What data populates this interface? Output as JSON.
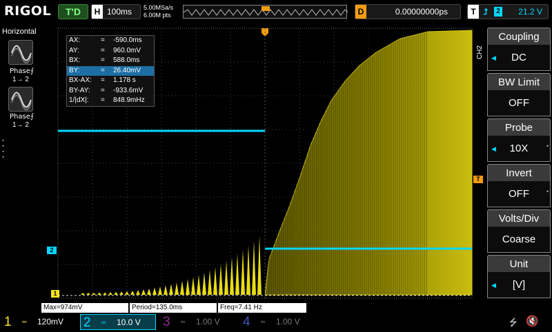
{
  "brand": "RIGOL",
  "trigger_status": "T'D",
  "horizontal": {
    "label": "H",
    "timebase": "100ms"
  },
  "sample_info": {
    "sample_rate": "5.00MSa/s",
    "memory_depth": "6.00M pts"
  },
  "delay": {
    "label": "D",
    "value": "0.00000000ps"
  },
  "trigger": {
    "label": "T",
    "edge_symbol": "⮥",
    "channel": "2",
    "level": "21.2 V"
  },
  "left_panel": {
    "title": "Horizontal",
    "buttons": [
      {
        "label": "Phase⨍",
        "sub": "1→ 2"
      },
      {
        "label": "Phase⨍",
        "sub": "1→ 2"
      }
    ]
  },
  "cursor_table": [
    {
      "key": "AX:",
      "eq": "=",
      "value": "-590.0ms",
      "selected": false
    },
    {
      "key": "AY:",
      "eq": "=",
      "value": "960.0mV",
      "selected": false
    },
    {
      "key": "BX:",
      "eq": "=",
      "value": "588.0ms",
      "selected": false
    },
    {
      "key": "BY:",
      "eq": "=",
      "value": "26.40mV",
      "selected": true
    },
    {
      "key": "BX-AX:",
      "eq": "=",
      "value": "1.178 s",
      "selected": false
    },
    {
      "key": "BY-AY:",
      "eq": "=",
      "value": "-933.6mV",
      "selected": false
    },
    {
      "key": "1/|dX|:",
      "eq": "=",
      "value": "848.9mHz",
      "selected": false
    }
  ],
  "measurements": {
    "max": "Max=974mV",
    "period": "Period=135.0ms",
    "freq": "Freq=7.41 Hz"
  },
  "markers": {
    "trigger_pos": "T",
    "ch2_marker": "2",
    "ch1_marker": "1",
    "trig_level_marker": "T"
  },
  "right_menu": {
    "channel_tag": "CH2",
    "items": [
      {
        "title": "Coupling",
        "value": "DC",
        "has_arrow": true
      },
      {
        "title": "BW Limit",
        "value": "OFF",
        "has_arrow": false
      },
      {
        "title": "Probe",
        "value": "10X",
        "has_arrow": true
      },
      {
        "title": "Invert",
        "value": "OFF",
        "has_arrow": false
      },
      {
        "title": "Volts/Div",
        "value": "Coarse",
        "has_arrow": false
      },
      {
        "title": "Unit",
        "value": "[V]",
        "has_arrow": true
      }
    ]
  },
  "channels": [
    {
      "num": "1",
      "coupling": "═",
      "scale": "120mV",
      "color": "#f7e51a",
      "active": true
    },
    {
      "num": "2",
      "coupling": "═",
      "scale": "10.0 V",
      "color": "#00d8ff",
      "active": true
    },
    {
      "num": "3",
      "coupling": "═",
      "scale": "1.00 V",
      "color": "#8a2f8a",
      "active": false
    },
    {
      "num": "4",
      "coupling": "═",
      "scale": "1.00 V",
      "color": "#3a55b5",
      "active": false
    }
  ],
  "colors": {
    "ch1": "#f7e51a",
    "ch2": "#00d8ff",
    "trigger": "#f39c12",
    "grid": "#6b6b6b"
  },
  "icons": {
    "usb": "usb-icon",
    "speaker": "speaker-mute-icon",
    "math": "sine-wave-icon"
  }
}
